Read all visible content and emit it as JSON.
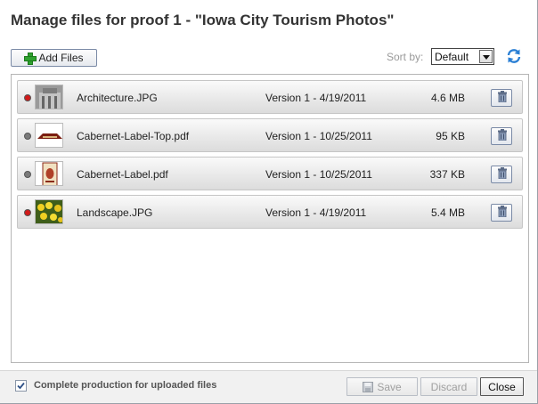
{
  "dialog": {
    "title": "Manage files for proof 1 - \"Iowa City Tourism Photos\""
  },
  "toolbar": {
    "add_files_label": "Add Files",
    "sort_label": "Sort by:",
    "sort_value": "Default",
    "refresh_icon": "refresh-icon"
  },
  "files": [
    {
      "status_color": "#d11a1a",
      "name": "Architecture.JPG",
      "version": "Version 1   -  4/19/2011",
      "size": "4.6 MB",
      "thumb": "architecture"
    },
    {
      "status_color": "#7a7a7a",
      "name": "Cabernet-Label-Top.pdf",
      "version": "Version 1  -  10/25/2011",
      "size": "95 KB",
      "thumb": "label-top"
    },
    {
      "status_color": "#7a7a7a",
      "name": "Cabernet-Label.pdf",
      "version": "Version 1  -  10/25/2011",
      "size": "337 KB",
      "thumb": "label"
    },
    {
      "status_color": "#d11a1a",
      "name": "Landscape.JPG",
      "version": "Version 1   -  4/19/2011",
      "size": "5.4 MB",
      "thumb": "landscape"
    }
  ],
  "footer": {
    "complete_checked": true,
    "complete_label": "Complete production for uploaded files",
    "save_label": "Save",
    "discard_label": "Discard",
    "close_label": "Close"
  }
}
